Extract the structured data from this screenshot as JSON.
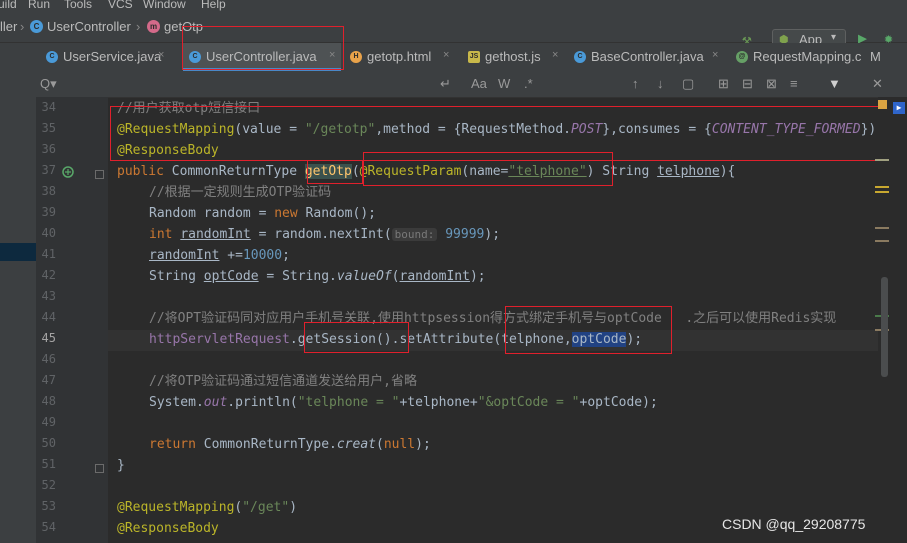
{
  "menu": [
    "uild",
    "Run",
    "Tools",
    "VCS",
    "Window",
    "Help"
  ],
  "breadcrumb": {
    "items": [
      {
        "label": "ller",
        "icon": "none"
      },
      {
        "label": "UserController",
        "icon": "class-icon"
      },
      {
        "label": "getOtp",
        "icon": "method-icon"
      }
    ],
    "method_icon_letter": "m",
    "class_icon_letter": "C"
  },
  "toolbar": {
    "run_config_label": "App",
    "run_config_chevron": "▾",
    "hammer_glyph": "⚒",
    "run_glyph": "▶",
    "debug_glyph": "✹"
  },
  "tabs": [
    {
      "label": "UserService.java",
      "icon_letter": "C",
      "icon_color": "#4a9ad8"
    },
    {
      "label": "UserController.java",
      "icon_letter": "C",
      "icon_color": "#4a9ad8"
    },
    {
      "label": "getotp.html",
      "icon_letter": "H",
      "icon_color": "#e8a24a"
    },
    {
      "label": "gethost.js",
      "icon_letter": "JS",
      "icon_color": "#c8b84a"
    },
    {
      "label": "BaseController.java",
      "icon_letter": "C",
      "icon_color": "#4a9ad8"
    },
    {
      "label": "RequestMapping.c",
      "icon_letter": "@",
      "icon_color": "#66a066"
    },
    {
      "label": "M",
      "icon_letter": "",
      "icon_color": ""
    }
  ],
  "tab_close": "×",
  "search": {
    "search_icon": "Q▾",
    "tools": [
      "↵",
      "Aa",
      "W",
      ".*",
      "↑",
      "↓",
      "▢",
      "⊞",
      "⊟",
      "⊠",
      "≡",
      "▼",
      "✕"
    ]
  },
  "gutter": {
    "line_numbers": [
      "34",
      "35",
      "36",
      "37",
      "38",
      "39",
      "40",
      "41",
      "42",
      "43",
      "44",
      "45",
      "46",
      "47",
      "48",
      "49",
      "50",
      "51",
      "52",
      "53",
      "54"
    ],
    "current_line": "45"
  },
  "code": {
    "l34": "//用户获取otp短信接口",
    "l35_ann": "@RequestMapping",
    "l35_a": "(value = ",
    "l35_str": "\"/getotp\"",
    "l35_b": ",method = {RequestMethod.",
    "l35_post": "POST",
    "l35_c": "},consumes = {",
    "l35_const": "CONTENT_TYPE_FORMED",
    "l35_d": "})",
    "l36_ann": "@ResponseBody",
    "l37_kw": "public ",
    "l37_type": "CommonReturnType ",
    "l37_method": "getOtp",
    "l37_paren": "(",
    "l37_ann": "@RequestParam",
    "l37_a": "(name=",
    "l37_str": "\"telphone\"",
    "l37_b": ") String ",
    "l37_param": "telphone",
    "l37_c": "){",
    "l38": "//根据一定规则生成OTP验证码",
    "l39_a": "Random random = ",
    "l39_kw": "new ",
    "l39_b": "Random();",
    "l40_kw": "int ",
    "l40_var": "randomInt",
    "l40_a": " = random.nextInt(",
    "l40_hint": "bound:",
    "l40_num": " 99999",
    "l40_b": ");",
    "l41_var": "randomInt",
    "l41_a": " +=",
    "l41_num": "10000",
    "l41_b": ";",
    "l42_a": "String ",
    "l42_var": "optCode",
    "l42_b": " = String.",
    "l42_it": "valueOf",
    "l42_c": "(",
    "l42_arg": "randomInt",
    "l42_d": ");",
    "l44": "//将OPT验证码同对应用户手机号关联,使用httpsession得方式绑定手机号与optCode   .之后可以使用Redis实现",
    "l45_field": "httpServletRequest",
    "l45_a": ".getSession().setAttribute(telphone,",
    "l45_sel": "optCode",
    "l45_b": ");",
    "l47": "//将OTP验证码通过短信通道发送给用户,省略",
    "l48_a": "System.",
    "l48_out": "out",
    "l48_b": ".println(",
    "l48_str1": "\"telphone = \"",
    "l48_c": "+telphone+",
    "l48_str2": "\"&optCode = \"",
    "l48_d": "+optCode);",
    "l50_kw": "return ",
    "l50_a": "CommonReturnType.",
    "l50_it": "creat",
    "l50_b": "(",
    "l50_null": "null",
    "l50_c": ");",
    "l51": "}",
    "l53_ann": "@RequestMapping",
    "l53_a": "(",
    "l53_str": "\"/get\"",
    "l53_b": ")",
    "l54_ann": "@ResponseBody"
  },
  "watermark": "CSDN @qq_29208775",
  "colors": {
    "keyword": "#cc7832",
    "annotation": "#bbb529",
    "string": "#6a8759",
    "comment": "#808080",
    "number": "#6897bb",
    "field": "#9876aa",
    "highlight_box": "#e0202c"
  }
}
